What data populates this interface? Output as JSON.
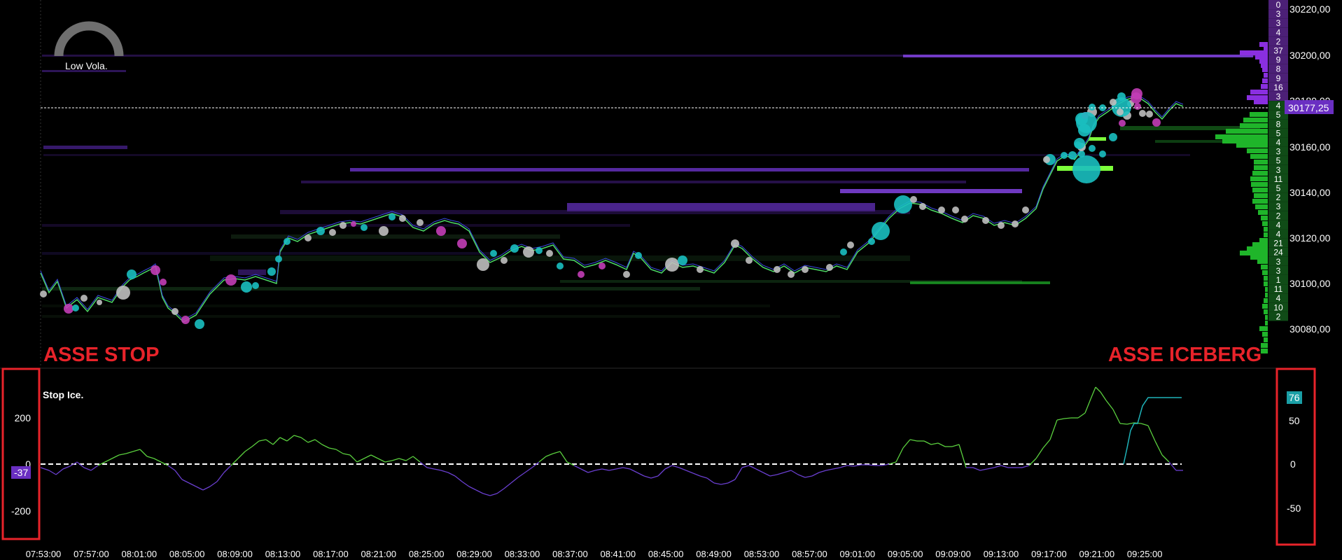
{
  "main_panel": {
    "gauge_label": "Low Vola.",
    "last_price": "30177,25",
    "price_ticks": [
      "30220,00",
      "30200,00",
      "30180,00",
      "30160,00",
      "30140,00",
      "30120,00",
      "30100,00",
      "30080,00"
    ],
    "depth_counts": [
      "0",
      "3",
      "3",
      "4",
      "2",
      "37",
      "9",
      "8",
      "9",
      "16",
      "3",
      "4",
      "5",
      "8",
      "5",
      "4",
      "3",
      "5",
      "3",
      "11",
      "5",
      "2",
      "3",
      "2",
      "4",
      "4",
      "21",
      "24",
      "3",
      "3",
      "1",
      "11",
      "4",
      "10",
      "2"
    ],
    "annotation_left": "ASSE STOP",
    "annotation_right": "ASSE ICEBERG"
  },
  "sub_panel": {
    "title": "Stop Ice.",
    "left_axis_ticks": [
      "200",
      "0",
      "-200"
    ],
    "left_value": "-37",
    "right_axis_ticks": [
      "50",
      "0",
      "-50"
    ],
    "right_value": "76"
  },
  "time_axis": [
    "07:53:00",
    "07:57:00",
    "08:01:00",
    "08:05:00",
    "08:09:00",
    "08:13:00",
    "08:17:00",
    "08:21:00",
    "08:25:00",
    "08:29:00",
    "08:33:00",
    "08:37:00",
    "08:41:00",
    "08:45:00",
    "08:49:00",
    "08:53:00",
    "08:57:00",
    "09:01:00",
    "09:05:00",
    "09:09:00",
    "09:13:00",
    "09:17:00",
    "09:21:00",
    "09:25:00"
  ],
  "colors": {
    "background": "#000000",
    "price_line": "#4CD964",
    "bid_heat": "#7B3FD6",
    "ask_heat": "#2E8B3A",
    "cyan_bubble": "#19BFC0",
    "magenta_bubble": "#C23DB6",
    "grey_bubble": "#BFBFBF",
    "annotation_red": "#E8232A",
    "stop_line": "#5ACF3E",
    "stop_line_negative": "#6A3FD0",
    "iceberg_line": "#1FB3B9",
    "value_badge_purple": "#6A2FC2",
    "value_badge_cyan": "#1A9FA6"
  }
}
